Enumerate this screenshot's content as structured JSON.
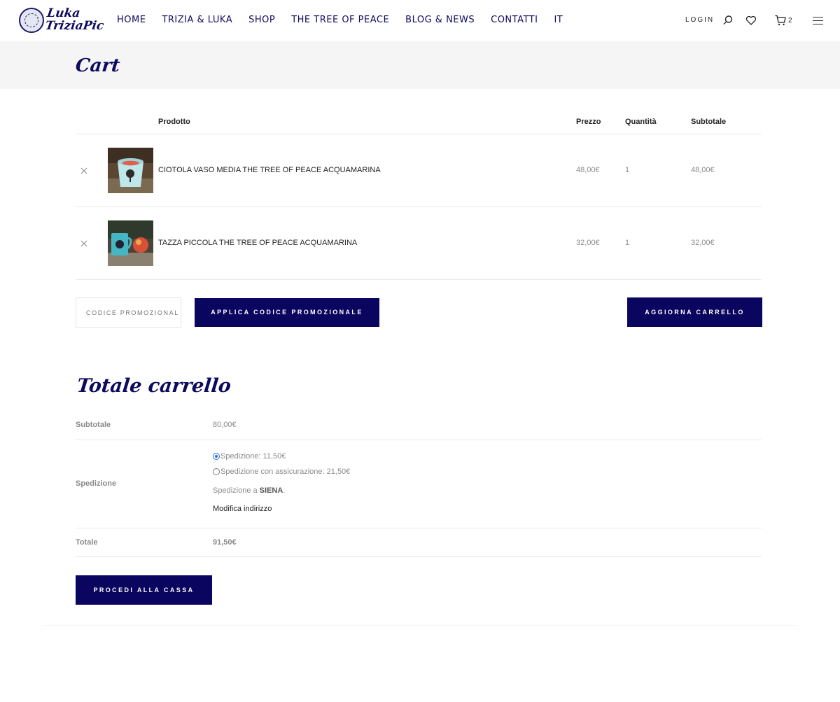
{
  "header": {
    "logo_text": "Luka TriziaPic",
    "nav": [
      "HOME",
      "TRIZIA & LUKA",
      "SHOP",
      "THE TREE OF PEACE",
      "BLOG & NEWS",
      "CONTATTI",
      "IT"
    ],
    "login_label": "LOGIN",
    "cart_count": "2"
  },
  "page": {
    "title": "Cart"
  },
  "cart": {
    "columns": {
      "product": "Prodotto",
      "price": "Prezzo",
      "quantity": "Quantità",
      "subtotal": "Subtotale"
    },
    "items": [
      {
        "name": "CIOTOLA VASO MEDIA THE TREE OF PEACE ACQUAMARINA",
        "price": "48,00€",
        "quantity": "1",
        "subtotal": "48,00€"
      },
      {
        "name": "TAZZA PICCOLA THE TREE OF PEACE ACQUAMARINA",
        "price": "32,00€",
        "quantity": "1",
        "subtotal": "32,00€"
      }
    ],
    "coupon_placeholder": "CODICE PROMOZIONAL",
    "apply_label": "APPLICA CODICE PROMOZIONALE",
    "update_label": "AGGIORNA CARRELLO"
  },
  "totals": {
    "title": "Totale carrello",
    "subtotal_label": "Subtotale",
    "subtotal_value": "80,00€",
    "shipping_label": "Spedizione",
    "shipping_options": [
      "Spedizione: 11,50€",
      "Spedizione con assicurazione: 21,50€"
    ],
    "shipping_dest_prefix": "Spedizione a ",
    "shipping_dest_city": "SIENA",
    "shipping_dest_suffix": ".",
    "modify_label": "Modifica indirizzo",
    "total_label": "Totale",
    "total_value": "91,50€",
    "checkout_label": "PROCEDI ALLA CASSA"
  },
  "colors": {
    "brand": "#0a055e",
    "radio_accent": "#1f6fe0"
  }
}
